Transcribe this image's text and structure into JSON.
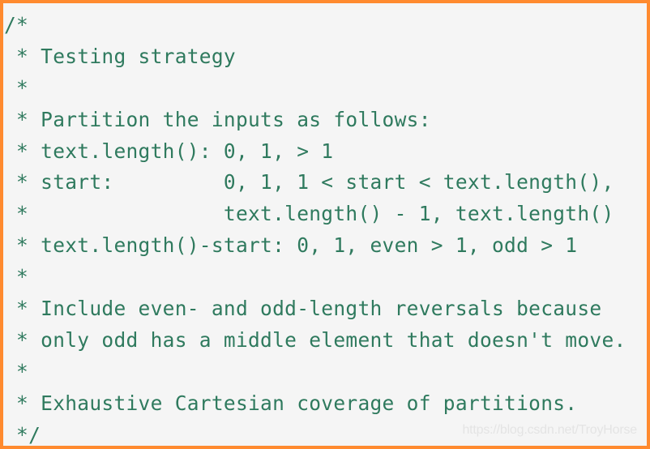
{
  "code_block": {
    "language": "comment",
    "lines": [
      "/*",
      " * Testing strategy",
      " *",
      " * Partition the inputs as follows:",
      " * text.length(): 0, 1, > 1",
      " * start:         0, 1, 1 < start < text.length(),",
      " *                text.length() - 1, text.length()",
      " * text.length()-start: 0, 1, even > 1, odd > 1",
      " *",
      " * Include even- and odd-length reversals because",
      " * only odd has a middle element that doesn't move.",
      " *",
      " * Exhaustive Cartesian coverage of partitions.",
      " */"
    ]
  },
  "watermark": "https://blog.csdn.net/TroyHorse",
  "colors": {
    "border": "#ff8a2f",
    "background": "#f5f5f5",
    "code_text": "#2f7a5e"
  }
}
